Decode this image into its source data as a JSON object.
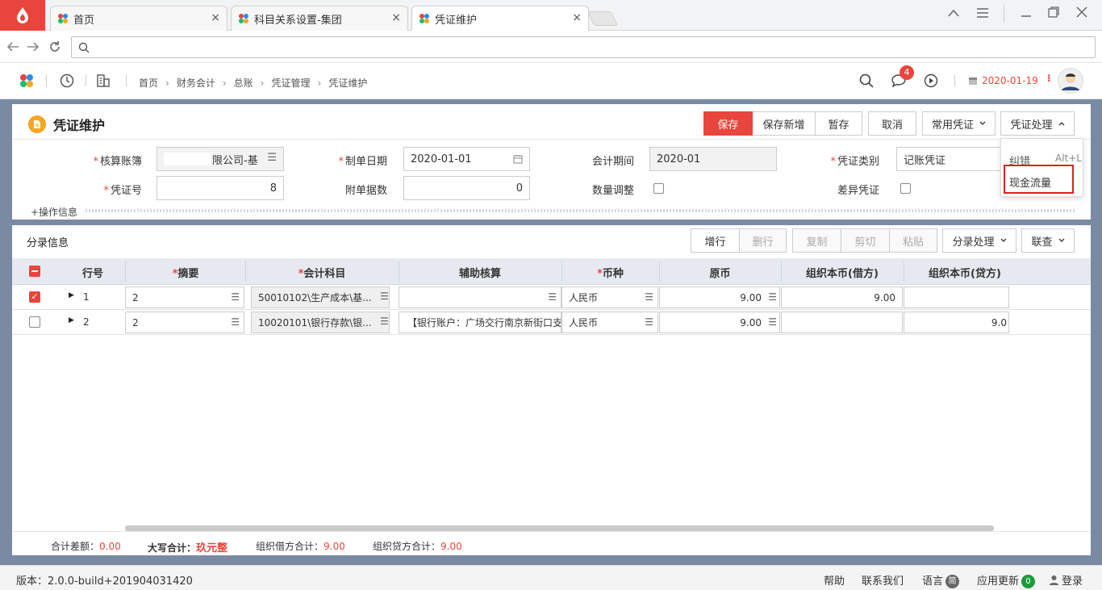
{
  "browser": {
    "tabs": [
      {
        "label": "首页"
      },
      {
        "label": "科目关系设置-集团"
      },
      {
        "label": "凭证维护"
      }
    ],
    "close_glyph": "×"
  },
  "header": {
    "breadcrumb": [
      "首页",
      "财务会计",
      "总账",
      "凭证管理",
      "凭证维护"
    ],
    "notification_count": "4",
    "date": "2020-01-19"
  },
  "page": {
    "title": "凭证维护",
    "toolbar": {
      "save": "保存",
      "save_new": "保存新增",
      "temp_save": "暂存",
      "cancel": "取消",
      "common_voucher": "常用凭证",
      "voucher_process": "凭证处理"
    },
    "menu": {
      "correct": "纠错",
      "correct_shortcut": "Alt+L",
      "cash_flow": "现金流量"
    },
    "form": {
      "book_label": "核算账簿",
      "book_value": "限公司-基",
      "date_label": "制单日期",
      "date_value": "2020-01-01",
      "period_label": "会计期间",
      "period_value": "2020-01",
      "type_label": "凭证类别",
      "type_value": "记账凭证",
      "no_label": "凭证号",
      "no_value": "8",
      "attach_label": "附单据数",
      "attach_value": "0",
      "qty_label": "数量调整",
      "diff_label": "差异凭证",
      "op_info": "+操作信息"
    },
    "entries": {
      "title": "分录信息",
      "buttons": {
        "add_row": "增行",
        "del_row": "删行",
        "copy": "复制",
        "cut": "剪切",
        "paste": "粘贴",
        "entry_process": "分录处理",
        "link_query": "联查"
      },
      "columns": [
        "行号",
        "摘要",
        "会计科目",
        "辅助核算",
        "币种",
        "原币",
        "组织本币(借方)",
        "组织本币(贷方)"
      ],
      "rows": [
        {
          "no": "1",
          "summary": "2",
          "account": "50010102\\生产成本\\基...",
          "aux": "",
          "currency": "人民币",
          "orig": "9.00",
          "debit": "9.00",
          "credit": "",
          "checked": true
        },
        {
          "no": "2",
          "summary": "2",
          "account": "10020101\\银行存款\\银...",
          "aux": "【银行账户：广场交行南京新街口支行",
          "currency": "人民币",
          "orig": "9.00",
          "debit": "",
          "credit": "9.0",
          "checked": false
        }
      ]
    },
    "totals": {
      "diff_label": "合计差额：",
      "diff_value": "0.00",
      "upper_label": "大写合计：",
      "upper_value": "玖元整",
      "debit_label": "组织借方合计：",
      "debit_value": "9.00",
      "credit_label": "组织贷方合计：",
      "credit_value": "9.00"
    }
  },
  "statusbar": {
    "version": "版本：2.0.0-build+201904031420",
    "help": "帮助",
    "contact": "联系我们",
    "language": "语言",
    "language_value": "简",
    "update": "应用更新",
    "update_count": "0",
    "login": "登录"
  },
  "colors": {
    "accent": "#e8453c",
    "header_bg": "#e6eaf0",
    "page_bg": "#7b8aa3"
  }
}
